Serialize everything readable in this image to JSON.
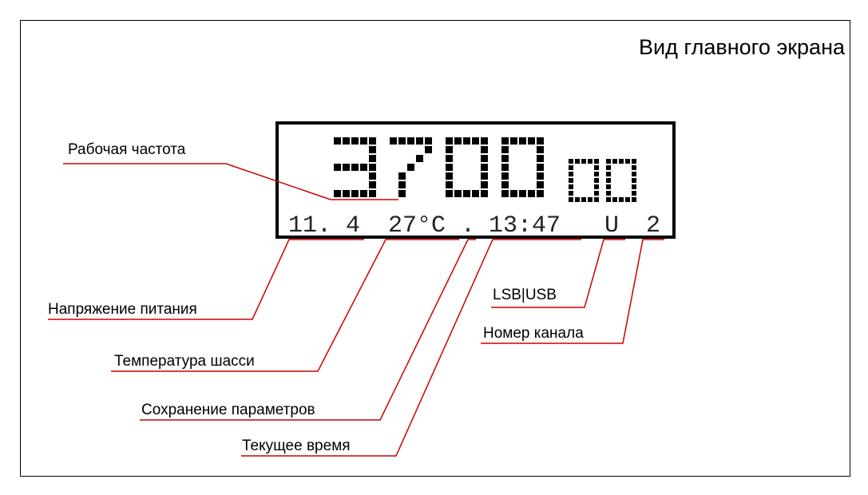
{
  "title": "Вид главного экрана",
  "colors": {
    "leader": "#cc0000",
    "text": "#000000",
    "display_border": "#000000",
    "display_pixels": "#000000"
  },
  "display": {
    "frequency_main": "3700",
    "frequency_sub": "00",
    "status": {
      "voltage": "11. 4",
      "temperature": "27°C",
      "save_flag": ".",
      "time": "13:47",
      "mode": "U",
      "channel": "2"
    }
  },
  "labels": {
    "frequency": "Рабочая частота",
    "voltage": "Напряжение питания",
    "temperature": "Температура шасси",
    "save": "Сохранение параметров",
    "time": "Текущее время",
    "mode": "LSB|USB",
    "channel": "Номер канала"
  }
}
